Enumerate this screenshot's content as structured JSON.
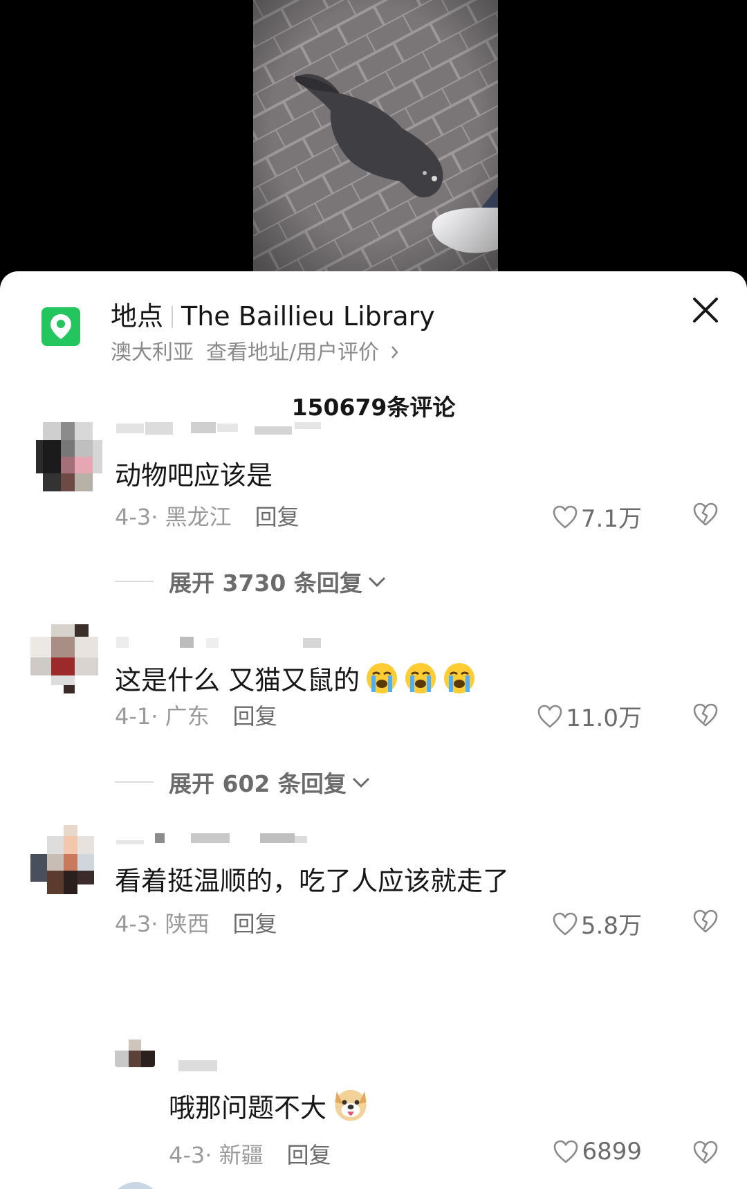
{
  "location": {
    "label": "地点",
    "name": "The Baillieu Library",
    "country": "澳大利亚",
    "details_link": "查看地址/用户评价",
    "icon": "map-pin-icon",
    "icon_color": "#22c55e"
  },
  "header": {
    "comment_count": "150679条评论",
    "close_icon": "close-icon"
  },
  "comments": [
    {
      "text": "动物吧应该是",
      "date_location": "4-3· 黑龙江",
      "reply_label": "回复",
      "likes": "7.1万",
      "expand_label": "展开 3730 条回复"
    },
    {
      "text": "这是什么 又猫又鼠的",
      "emoji": [
        "crying-face",
        "crying-face",
        "crying-face"
      ],
      "date_location": "4-1· 广东",
      "reply_label": "回复",
      "likes": "11.0万",
      "expand_label": "展开 602 条回复"
    },
    {
      "text": "看着挺温顺的，吃了人应该就走了",
      "date_location": "4-3· 陕西",
      "reply_label": "回复",
      "likes": "5.8万"
    }
  ],
  "reply": {
    "text": "哦那问题不大",
    "emoji": "dog-face-tongue",
    "date_location": "4-3· 新疆",
    "reply_label": "回复",
    "likes": "6899"
  }
}
